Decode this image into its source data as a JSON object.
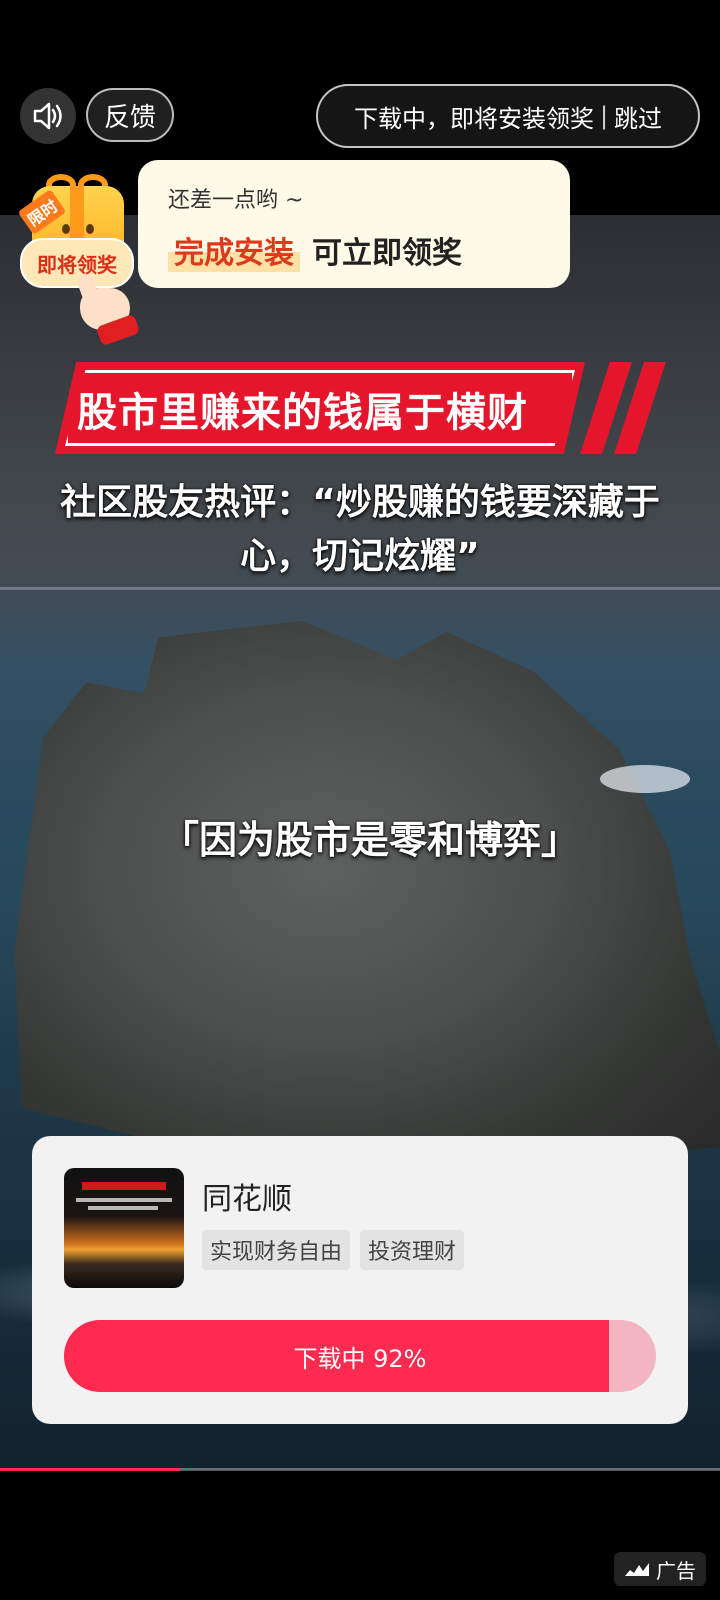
{
  "top_bar": {
    "feedback_label": "反馈",
    "download_status": "下载中，即将安装领奖",
    "skip_label": "跳过"
  },
  "reward": {
    "flash_tag": "限时",
    "soon_label": "即将领奖",
    "hint": "还差一点哟 ~",
    "highlight": "完成安装",
    "rest": "可立即领奖"
  },
  "video": {
    "banner_title": "股市里赚来的钱属于横财",
    "subtitle": "社区股友热评：“炒股赚的钱要深藏于心，切记炫耀”",
    "caption": "「因为股市是零和博弈」"
  },
  "app_card": {
    "app_name": "同花顺",
    "tags": [
      "实现财务自由",
      "投资理财"
    ],
    "progress_label": "下载中 92%",
    "progress_value": 0.92
  },
  "video_progress": 0.25,
  "ad_label": "广告",
  "colors": {
    "accent": "#ff2a4f",
    "banner_red": "#e5152c",
    "bubble_bg": "#fffbe8"
  }
}
